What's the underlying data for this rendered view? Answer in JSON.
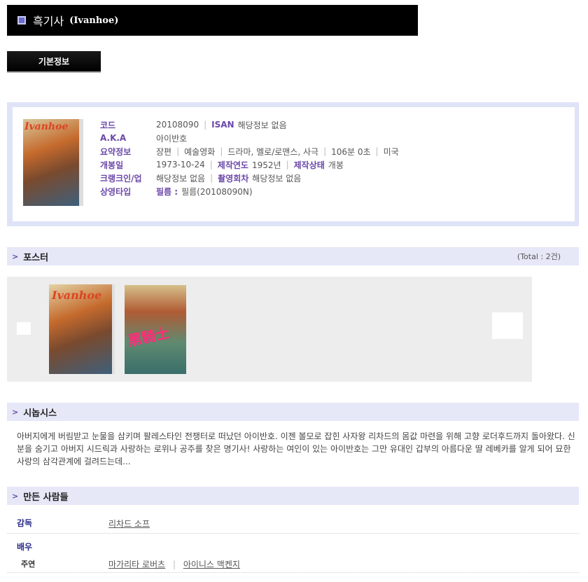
{
  "header": {
    "title": "흑기사",
    "subtitle": "(Ivanhoe)"
  },
  "tabs": {
    "basic_info": "기본정보"
  },
  "info": {
    "poster_title": "Ivanhoe",
    "code_label": "코드",
    "code_value": "20108090",
    "isan_label": "ISAN",
    "isan_value": "해당정보 없음",
    "aka_label": "A.K.A",
    "aka_value": "아이반호",
    "summary_label": "요약정보",
    "summary_items": [
      "장편",
      "예술영화",
      "드라마, 멜로/로맨스, 사극",
      "106분 0초",
      "미국"
    ],
    "release_label": "개봉일",
    "release_value": "1973-10-24",
    "prod_year_label": "제작연도",
    "prod_year_value": "1952년",
    "prod_status_label": "제작상태",
    "prod_status_value": "개봉",
    "crankin_label": "크랭크인/업",
    "crankin_value": "해당정보 없음",
    "shoot_count_label": "촬영회차",
    "shoot_count_value": "해당정보 없음",
    "screen_type_label": "상영타입",
    "film_label": "필름 :",
    "film_value": "필름(20108090N)"
  },
  "poster_section": {
    "title": "포스터",
    "total": "(Total : 2건)",
    "poster1_title": "Ivanhoe",
    "poster2_title": "黑騎士"
  },
  "synopsis_section": {
    "title": "시놉시스",
    "text": "아버지에게 버림받고 눈물을 삼키며 팔레스타인 전쟁터로 떠났던 아이반호. 이젠 볼모로 잡힌 사자왕 리차드의 몸값 마련을 위해 고향 로더후드까지 돌아왔다. 신분을 숨기고 아버지 시드릭과 사랑하는 로위나 공주를 찾은 명기사! 사랑하는 여인이 있는 아이반호는 그만 유대인 갑부의 아름다운 딸 레베카를 알게 되어 묘한 사랑의 삼각관계에 걸려드는데..."
  },
  "credits_section": {
    "title": "만든 사람들",
    "director_label": "감독",
    "director_name": "리차드 소프",
    "actor_label": "배우",
    "lead_label": "주연",
    "lead_names": [
      "마가리타 로버츠",
      "아이니스 맥켄지"
    ]
  }
}
